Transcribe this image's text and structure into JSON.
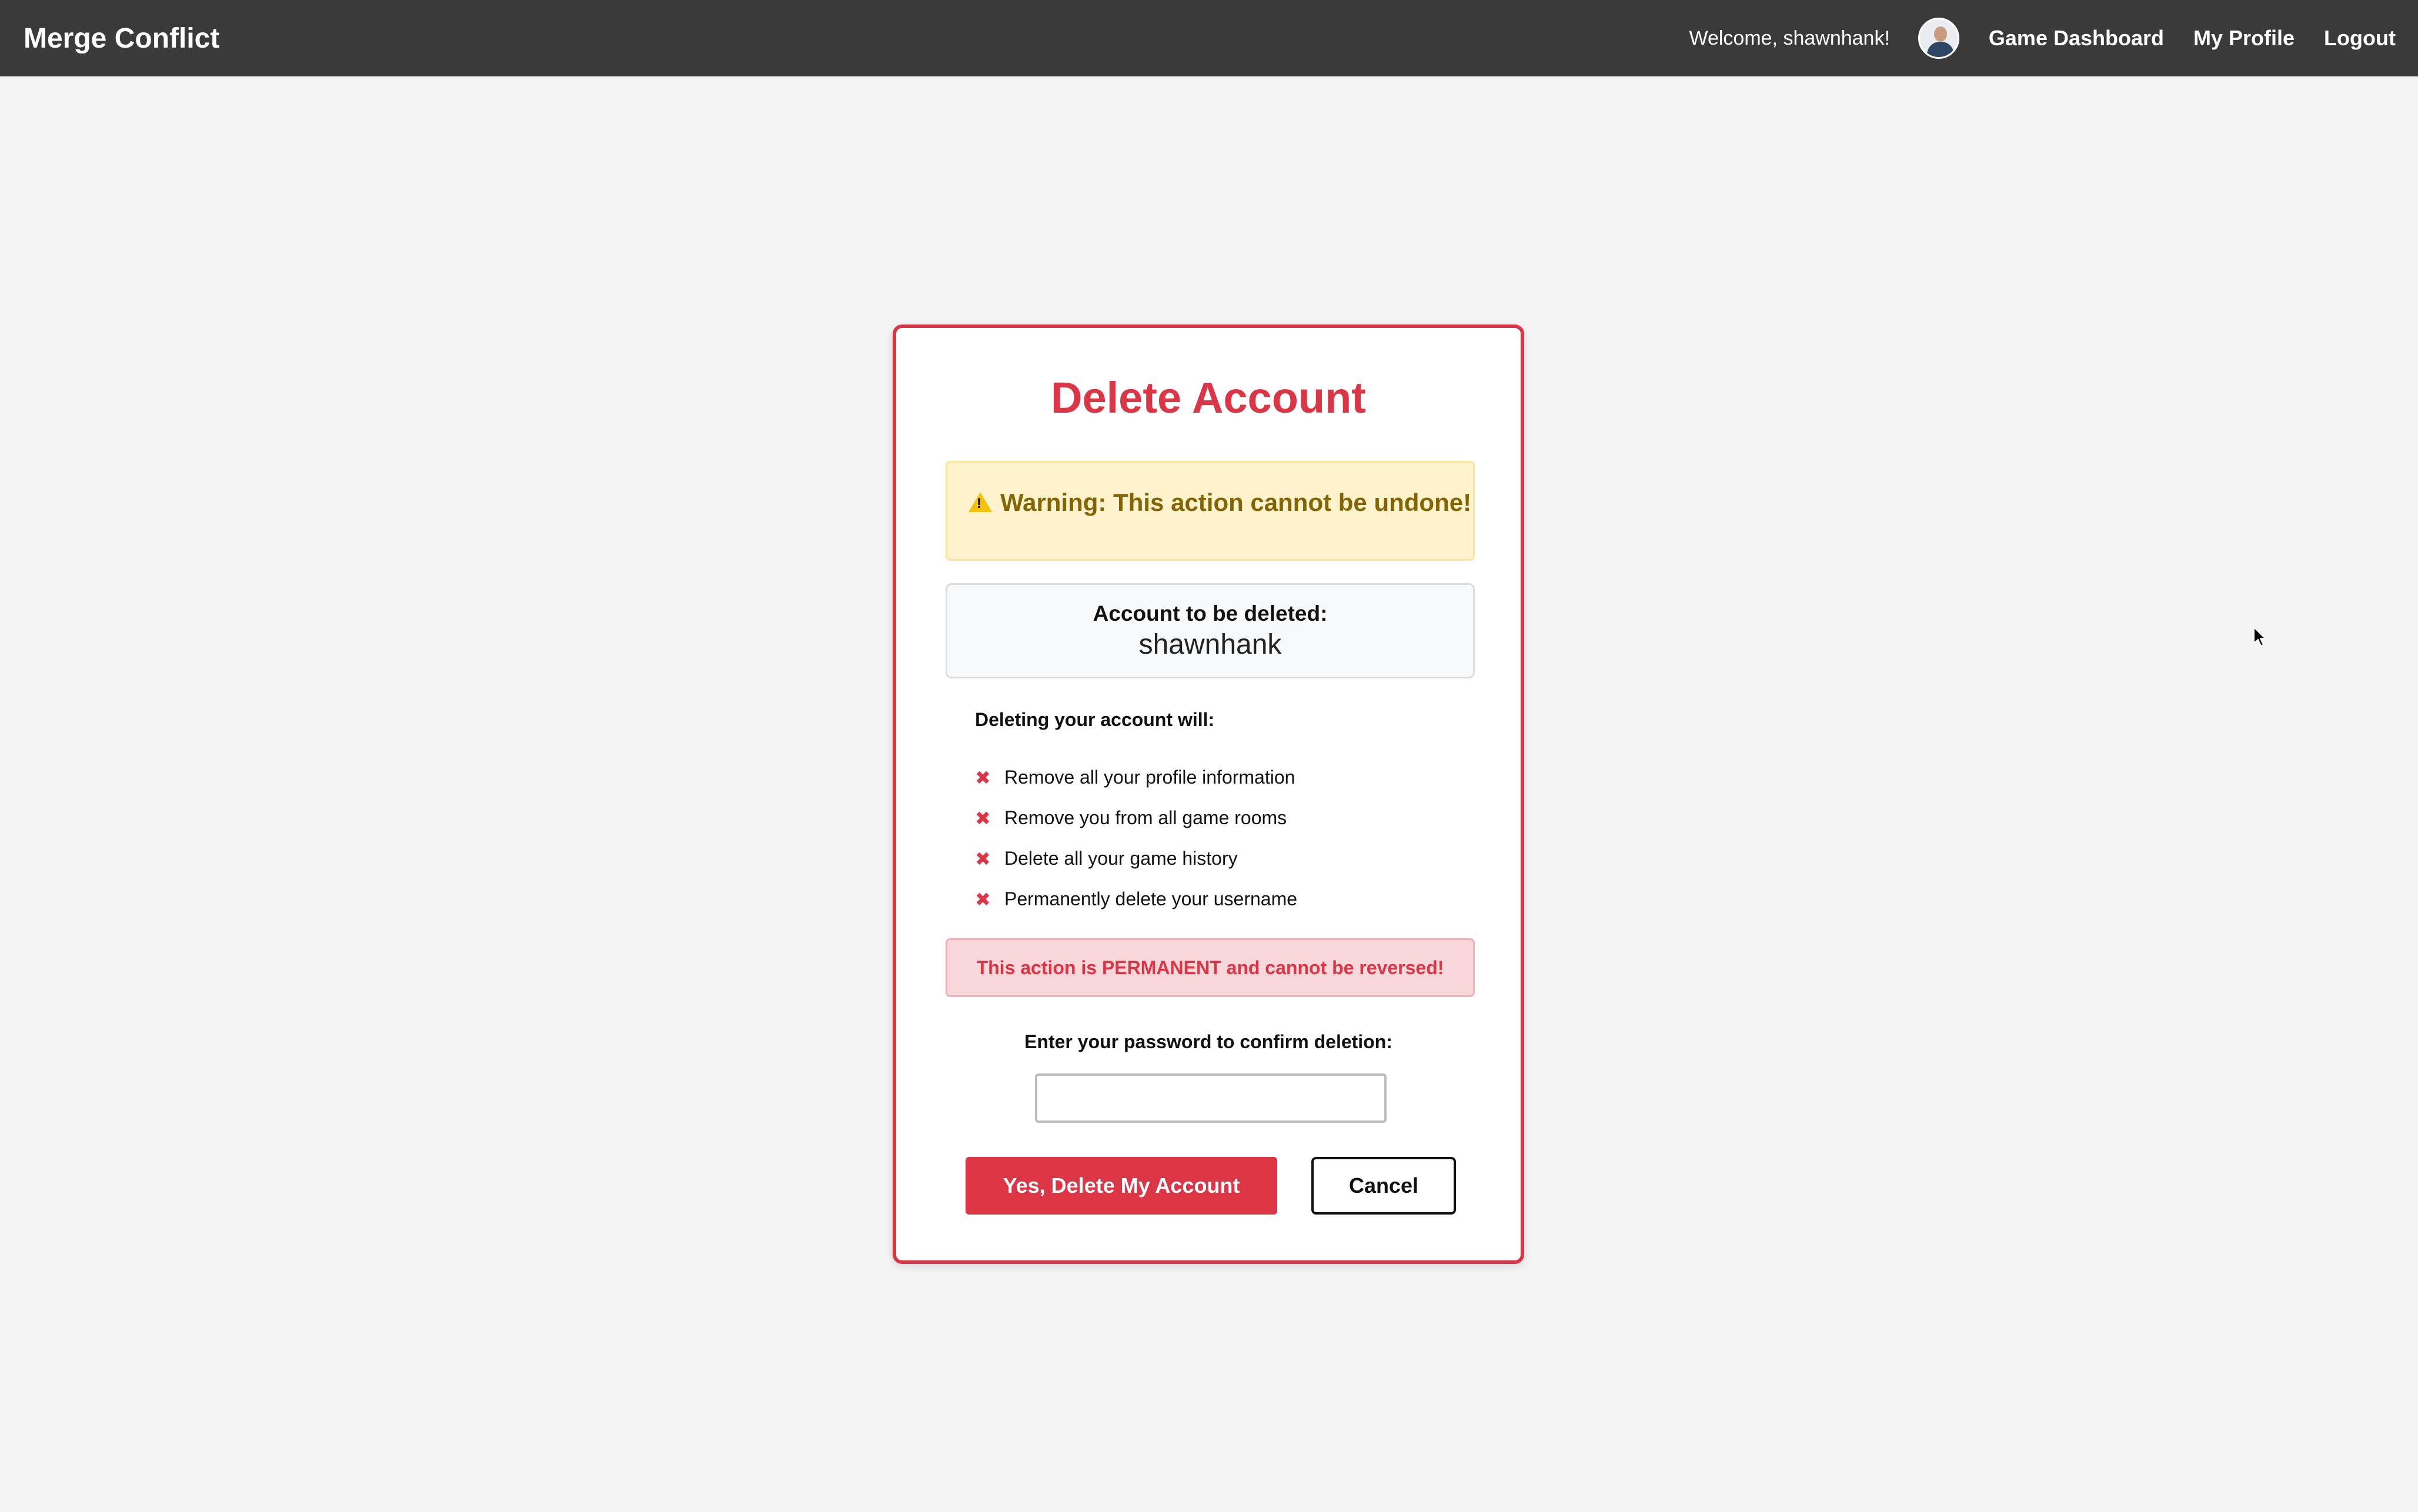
{
  "navbar": {
    "brand": "Merge Conflict",
    "welcome": "Welcome, shawnhank!",
    "links": [
      "Game Dashboard",
      "My Profile",
      "Logout"
    ]
  },
  "dialog": {
    "title": "Delete Account",
    "warning": "Warning: This action cannot be undone!",
    "account_label": "Account to be deleted:",
    "account_name": "shawnhank",
    "consequences_heading": "Deleting your account will:",
    "consequences": [
      "Remove all your profile information",
      "Remove you from all game rooms",
      "Delete all your game history",
      "Permanently delete your username"
    ],
    "permanent_notice": "This action is PERMANENT and cannot be reversed!",
    "password_label": "Enter your password to confirm deletion:",
    "password_value": "",
    "confirm_button": "Yes, Delete My Account",
    "cancel_button": "Cancel"
  },
  "colors": {
    "navbar_bg": "#3a3a3a",
    "danger": "#dc3545",
    "warning_bg": "#fff3cd",
    "warning_text": "#856404",
    "page_bg": "#f4f4f4"
  },
  "icons": {
    "warning": "warning-triangle-icon",
    "consequence": "x-mark-icon",
    "avatar": "user-avatar"
  }
}
